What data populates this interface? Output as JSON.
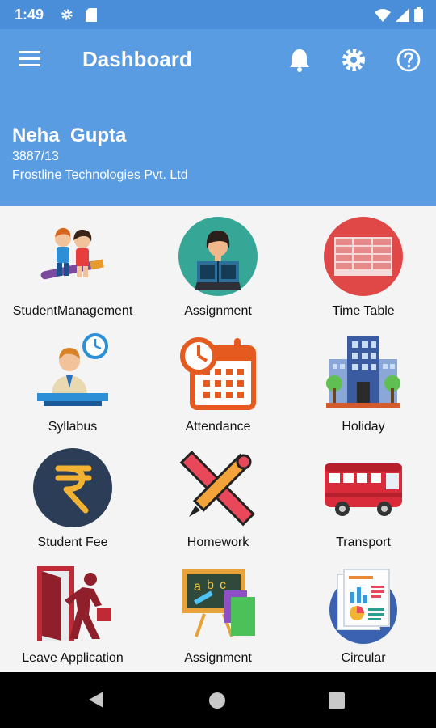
{
  "status_bar": {
    "time": "1:49",
    "icons": [
      "gear-icon",
      "sd-card-icon",
      "wifi-icon",
      "signal-icon",
      "battery-icon"
    ]
  },
  "app_bar": {
    "title": "Dashboard",
    "icons": [
      "menu-icon",
      "bell-icon",
      "gear-icon",
      "help-icon"
    ],
    "color": "#5a9ce2"
  },
  "profile": {
    "name": "Neha  Gupta",
    "id": "3887/13",
    "company": "Frostline Technologies Pvt. Ltd"
  },
  "tiles": [
    {
      "label": "StudentManagement",
      "icon": "students-icon"
    },
    {
      "label": "Assignment",
      "icon": "reading-student-icon"
    },
    {
      "label": "Time Table",
      "icon": "timetable-icon"
    },
    {
      "label": "Syllabus",
      "icon": "teacher-clock-icon"
    },
    {
      "label": "Attendance",
      "icon": "calendar-icon"
    },
    {
      "label": "Holiday",
      "icon": "building-icon"
    },
    {
      "label": "Student Fee",
      "icon": "rupee-icon"
    },
    {
      "label": "Homework",
      "icon": "pencil-ruler-icon"
    },
    {
      "label": "Transport",
      "icon": "bus-icon"
    },
    {
      "label": "Leave Application",
      "icon": "exit-door-icon"
    },
    {
      "label": "Assignment",
      "icon": "blackboard-icon"
    },
    {
      "label": "Circular",
      "icon": "report-icon"
    }
  ],
  "nav_bar": {
    "icons": [
      "back-icon",
      "home-icon",
      "recent-apps-icon"
    ]
  }
}
